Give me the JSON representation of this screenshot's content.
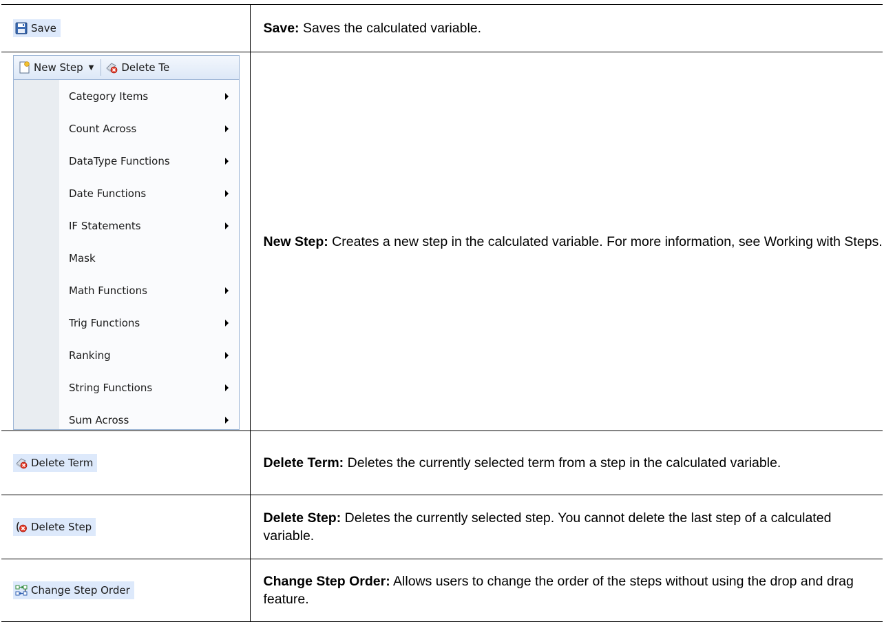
{
  "rows": [
    {
      "button_label": "Save",
      "icon": "floppy-disk-icon",
      "title": "Save:",
      "description": " Saves the calculated variable."
    },
    {
      "toolbar": {
        "new_step_label": "New Step",
        "delete_term_label": "Delete Te"
      },
      "menu_items": [
        {
          "label": "Category Items",
          "has_submenu": true
        },
        {
          "label": "Count Across",
          "has_submenu": true
        },
        {
          "label": "DataType Functions",
          "has_submenu": true
        },
        {
          "label": "Date Functions",
          "has_submenu": true
        },
        {
          "label": "IF Statements",
          "has_submenu": true
        },
        {
          "label": "Mask",
          "has_submenu": false
        },
        {
          "label": "Math Functions",
          "has_submenu": true
        },
        {
          "label": "Trig Functions",
          "has_submenu": true
        },
        {
          "label": "Ranking",
          "has_submenu": true
        },
        {
          "label": "String Functions",
          "has_submenu": true
        },
        {
          "label": "Sum Across",
          "has_submenu": true
        }
      ],
      "title": "New Step:",
      "description": " Creates a new step in the calculated variable. For more information, see Working with Steps."
    },
    {
      "button_label": "Delete Term",
      "icon": "eraser-delete-icon",
      "title": "Delete Term:",
      "description": " Deletes the currently selected term from a step in the calculated variable."
    },
    {
      "button_label": "Delete Step",
      "icon": "parenthesis-delete-icon",
      "title": "Delete Step:",
      "description": " Deletes the currently selected step. You cannot delete the last step of a calculated variable."
    },
    {
      "button_label": "Change Step Order",
      "icon": "reorder-icon",
      "title": "Change Step Order:",
      "description": " Allows users to change the order of the steps without using the drop and drag feature."
    }
  ],
  "colors": {
    "button_highlight": "#dde9fb",
    "menu_gutter": "#e9edf1",
    "menu_border": "#9eb6d6"
  }
}
